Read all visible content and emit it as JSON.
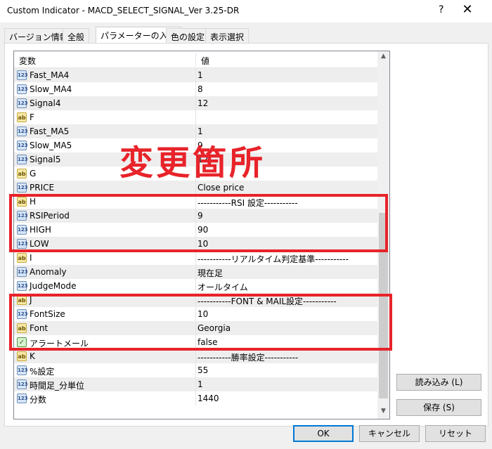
{
  "window": {
    "title": "Custom Indicator - MACD_SELECT_SIGNAL_Ver  3.25-DR",
    "help_glyph": "?",
    "close_glyph": "✕"
  },
  "tabs": [
    {
      "label": "バージョン情報"
    },
    {
      "label": "全般"
    },
    {
      "label": "パラメーターの入力"
    },
    {
      "label": "色の設定"
    },
    {
      "label": "表示選択"
    }
  ],
  "grid": {
    "col_name": "変数",
    "col_value": "値",
    "rows": [
      {
        "icon": "123",
        "name": "Fast_MA4",
        "value": "1"
      },
      {
        "icon": "123",
        "name": "Slow_MA4",
        "value": "8"
      },
      {
        "icon": "123",
        "name": "Signal4",
        "value": "12"
      },
      {
        "icon": "ab",
        "name": "F",
        "value": ""
      },
      {
        "icon": "123",
        "name": "Fast_MA5",
        "value": "1"
      },
      {
        "icon": "123",
        "name": "Slow_MA5",
        "value": "9"
      },
      {
        "icon": "123",
        "name": "Signal5",
        "value": "12"
      },
      {
        "icon": "ab",
        "name": "G",
        "value": ""
      },
      {
        "icon": "123",
        "name": "PRICE",
        "value": "Close price"
      },
      {
        "icon": "ab",
        "name": "H",
        "value": "-----------RSI 設定-----------"
      },
      {
        "icon": "123",
        "name": "RSIPeriod",
        "value": "9"
      },
      {
        "icon": "123",
        "name": "HIGH",
        "value": "90"
      },
      {
        "icon": "123",
        "name": "LOW",
        "value": "10"
      },
      {
        "icon": "ab",
        "name": "I",
        "value": "-----------リアルタイム判定基準-----------"
      },
      {
        "icon": "123",
        "name": "Anomaly",
        "value": "現在足"
      },
      {
        "icon": "123",
        "name": "JudgeMode",
        "value": "オールタイム"
      },
      {
        "icon": "ab",
        "name": "J",
        "value": "-----------FONT & MAIL設定-----------"
      },
      {
        "icon": "123",
        "name": "FontSize",
        "value": "10"
      },
      {
        "icon": "ab",
        "name": "Font",
        "value": "Georgia"
      },
      {
        "icon": "bool",
        "name": "アラートメール",
        "value": "false"
      },
      {
        "icon": "ab",
        "name": "K",
        "value": "-----------勝率設定-----------"
      },
      {
        "icon": "123",
        "name": "%設定",
        "value": "55"
      },
      {
        "icon": "123",
        "name": "時間足_分単位",
        "value": "1"
      },
      {
        "icon": "123",
        "name": "分数",
        "value": "1440"
      }
    ]
  },
  "annotation": "変更箇所",
  "buttons": {
    "load": "読み込み (L)",
    "save": "保存 (S)",
    "ok": "OK",
    "cancel": "キャンセル",
    "reset": "リセット"
  },
  "colors": {
    "highlight": "#e8232a",
    "focus_border": "#0078d7"
  }
}
